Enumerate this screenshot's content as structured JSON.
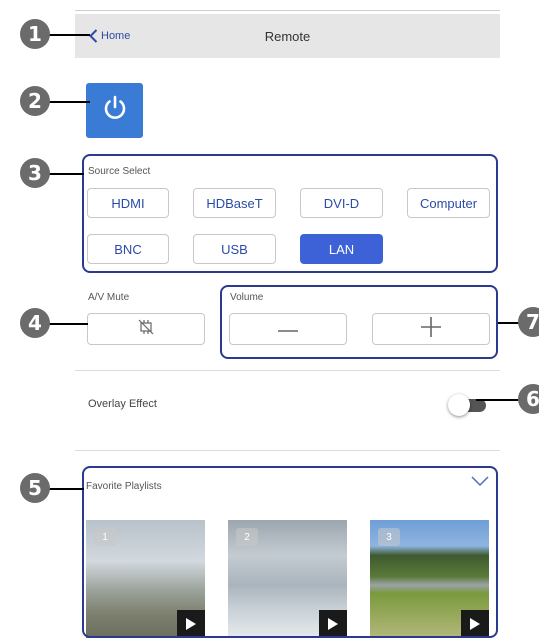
{
  "header": {
    "back_label": "Home",
    "title": "Remote"
  },
  "source_select": {
    "label": "Source Select",
    "buttons": [
      "HDMI",
      "HDBaseT",
      "DVI-D",
      "Computer",
      "BNC",
      "USB",
      "LAN"
    ],
    "active": "LAN"
  },
  "av_mute": {
    "label": "A/V Mute",
    "icon": "av-mute-icon"
  },
  "volume": {
    "label": "Volume",
    "minus": "—",
    "plus": "+"
  },
  "overlay": {
    "label": "Overlay Effect",
    "enabled": false
  },
  "playlists": {
    "label": "Favorite Playlists",
    "items": [
      {
        "number": "1"
      },
      {
        "number": "2"
      },
      {
        "number": "3"
      }
    ]
  },
  "callouts": [
    "1",
    "2",
    "3",
    "4",
    "5",
    "6",
    "7"
  ],
  "colors": {
    "accent": "#3d62d8",
    "power": "#3a7bd5",
    "header_bg": "#e6e6e6",
    "callout_box": "#2a3b8f",
    "marker": "#6b6b6b"
  }
}
